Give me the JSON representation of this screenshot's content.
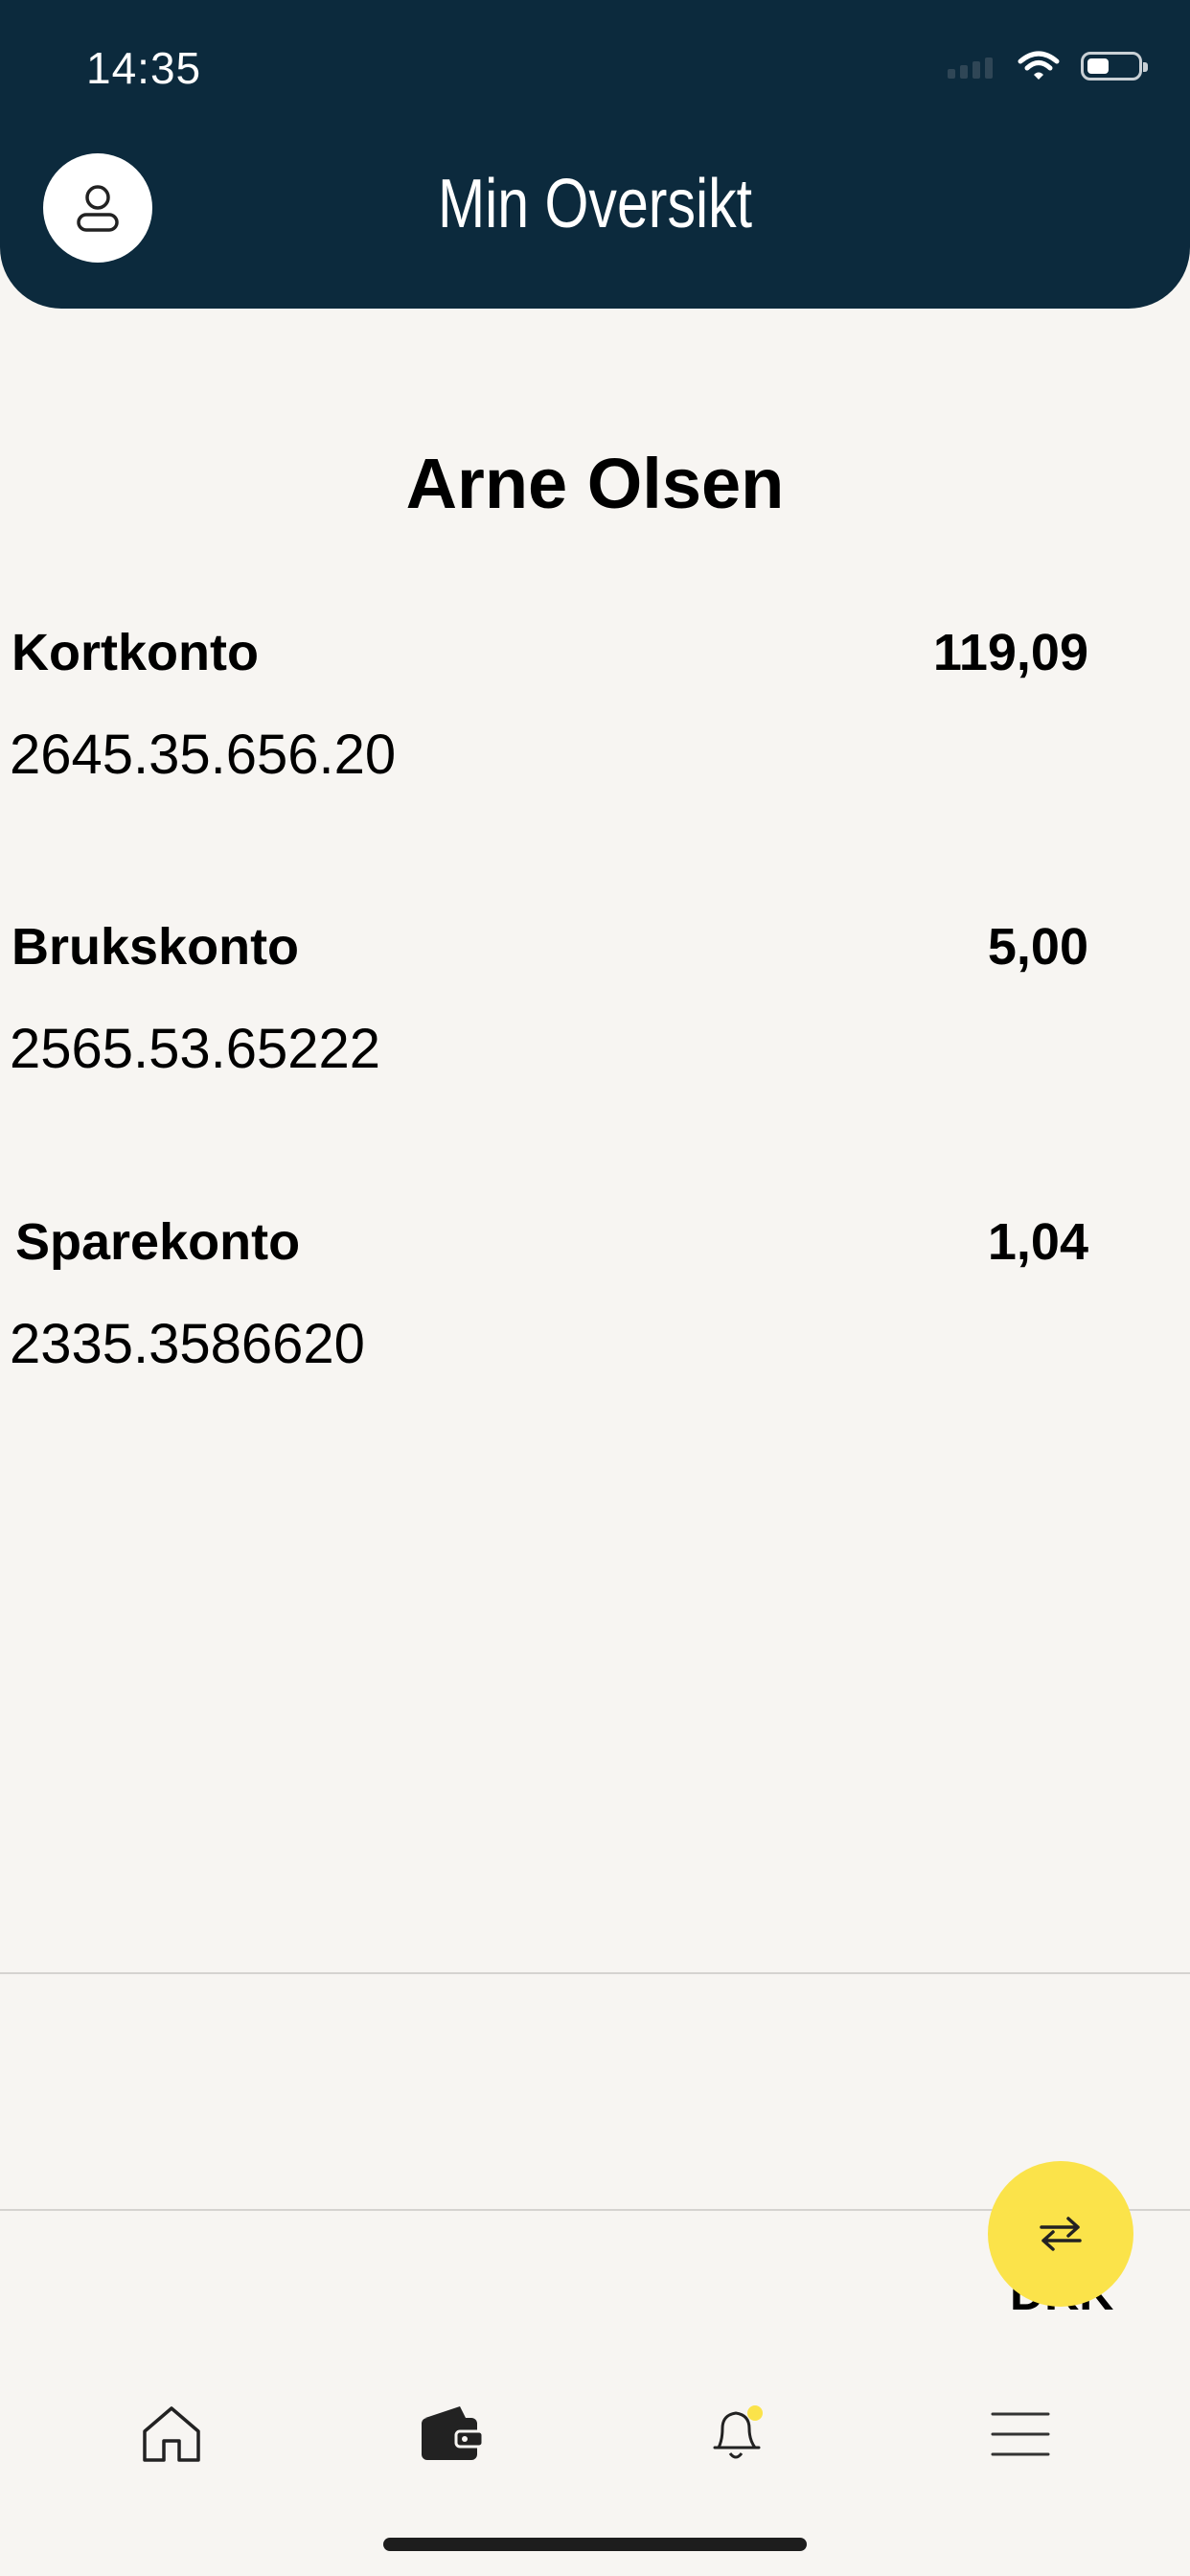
{
  "status_bar": {
    "time": "14:35"
  },
  "header": {
    "title": "Min Oversikt",
    "profile_icon": "user-icon"
  },
  "owner_name": "Arne Olsen",
  "accounts": [
    {
      "name": "Kortkonto",
      "number": "2645.35.656.20",
      "balance": "119,09"
    },
    {
      "name": "Brukskonto",
      "number": "2565.53.65222",
      "balance": "5,00"
    },
    {
      "name": "Sparekonto",
      "number": "2335.3586620",
      "balance": "1,04"
    }
  ],
  "currency_label": "DKK",
  "fab": {
    "icon": "transfer-arrows-icon",
    "color": "#fbe34a"
  },
  "tab_bar": [
    {
      "icon": "home-icon"
    },
    {
      "icon": "wallet-icon",
      "active": true
    },
    {
      "icon": "bell-icon",
      "badge_color": "#fbe34a"
    },
    {
      "icon": "menu-icon"
    }
  ],
  "colors": {
    "header": "#0c2a3d",
    "background": "#f7f5f2",
    "accent": "#fbe34a"
  }
}
